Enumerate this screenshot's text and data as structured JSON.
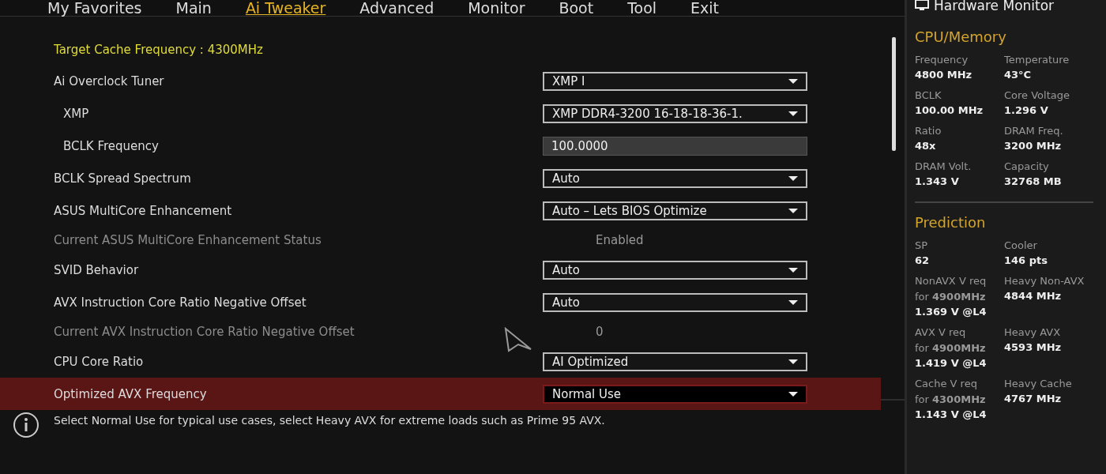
{
  "tabs": [
    {
      "label": "My Favorites",
      "selected": false
    },
    {
      "label": "Main",
      "selected": false
    },
    {
      "label": "Ai Tweaker",
      "selected": true
    },
    {
      "label": "Advanced",
      "selected": false
    },
    {
      "label": "Monitor",
      "selected": false
    },
    {
      "label": "Boot",
      "selected": false
    },
    {
      "label": "Tool",
      "selected": false
    },
    {
      "label": "Exit",
      "selected": false
    }
  ],
  "settings": [
    {
      "kind": "info",
      "label": "Target Cache Frequency : 4300MHz",
      "selected": false
    },
    {
      "kind": "dropdown",
      "label": "Ai Overclock Tuner",
      "value": "XMP I",
      "selected": false,
      "children": [
        {
          "kind": "dropdown",
          "label": "XMP",
          "value": "XMP DDR4-3200 16-18-18-36-1.",
          "selected": false
        },
        {
          "kind": "field",
          "label": "BCLK Frequency",
          "value": "100.0000",
          "selected": false
        }
      ]
    },
    {
      "kind": "dropdown",
      "label": "BCLK Spread Spectrum",
      "value": "Auto",
      "selected": false
    },
    {
      "kind": "dropdown",
      "label": "ASUS MultiCore Enhancement",
      "value": "Auto – Lets BIOS Optimize",
      "selected": false
    },
    {
      "kind": "status",
      "label": "Current ASUS MultiCore Enhancement Status",
      "value": "Enabled",
      "selected": false
    },
    {
      "kind": "dropdown",
      "label": "SVID Behavior",
      "value": "Auto",
      "selected": false
    },
    {
      "kind": "dropdown",
      "label": "AVX Instruction Core Ratio Negative Offset",
      "value": "Auto",
      "selected": false
    },
    {
      "kind": "status",
      "label": "Current AVX Instruction Core Ratio Negative Offset",
      "value": "0",
      "selected": false
    },
    {
      "kind": "dropdown",
      "label": "CPU Core Ratio",
      "value": "AI Optimized",
      "selected": false
    },
    {
      "kind": "dropdown",
      "label": "Optimized AVX Frequency",
      "value": "Normal Use",
      "selected": true
    }
  ],
  "help": "Select Normal Use for typical use cases, select Heavy AVX for extreme loads such as Prime 95 AVX.",
  "monitor": {
    "title": "Hardware Monitor",
    "sections": [
      {
        "title": "CPU/Memory",
        "cells": [
          {
            "label": "Frequency",
            "value": "4800 MHz"
          },
          {
            "label": "Temperature",
            "value": "43°C"
          },
          {
            "label": "BCLK",
            "value": "100.00 MHz"
          },
          {
            "label": "Core Voltage",
            "value": "1.296 V"
          },
          {
            "label": "Ratio",
            "value": "48x"
          },
          {
            "label": "DRAM Freq.",
            "value": "3200 MHz"
          },
          {
            "label": "DRAM Volt.",
            "value": "1.343 V"
          },
          {
            "label": "Capacity",
            "value": "32768 MB"
          }
        ]
      },
      {
        "title": "Prediction",
        "cells": [
          {
            "label": "SP",
            "value": "62"
          },
          {
            "label": "Cooler",
            "value": "146 pts"
          },
          {
            "label": "NonAVX V req",
            "sublabel": "for **4900MHz**",
            "value": "1.369 V @L4"
          },
          {
            "label": "Heavy Non-AVX",
            "value": "4844 MHz"
          },
          {
            "label": "AVX V req",
            "sublabel": "for **4900MHz**",
            "value": "1.419 V @L4"
          },
          {
            "label": "Heavy AVX",
            "value": "4593 MHz"
          },
          {
            "label": "Cache V req",
            "sublabel": "for **4300MHz**",
            "value": "1.143 V @L4"
          },
          {
            "label": "Heavy Cache",
            "value": "4767 MHz"
          }
        ]
      }
    ]
  }
}
